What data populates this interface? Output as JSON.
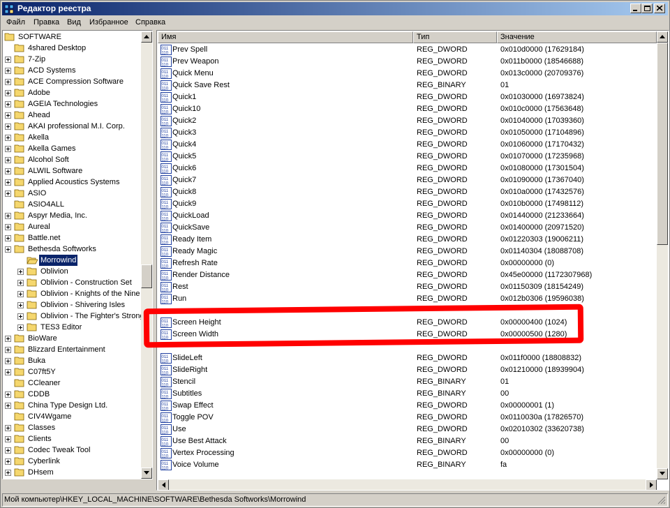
{
  "window": {
    "title": "Редактор реестра",
    "minimize_icon": "minimize-icon",
    "maximize_icon": "maximize-icon",
    "close_icon": "close-icon"
  },
  "menu": [
    "Файл",
    "Правка",
    "Вид",
    "Избранное",
    "Справка"
  ],
  "tree": {
    "root": "SOFTWARE",
    "items": [
      {
        "label": "4shared Desktop",
        "depth": 1,
        "expander": false
      },
      {
        "label": "7-Zip",
        "depth": 1,
        "expander": true
      },
      {
        "label": "ACD Systems",
        "depth": 1,
        "expander": true
      },
      {
        "label": "ACE Compression Software",
        "depth": 1,
        "expander": true
      },
      {
        "label": "Adobe",
        "depth": 1,
        "expander": true
      },
      {
        "label": "AGEIA Technologies",
        "depth": 1,
        "expander": true
      },
      {
        "label": "Ahead",
        "depth": 1,
        "expander": true
      },
      {
        "label": "AKAI professional M.I. Corp.",
        "depth": 1,
        "expander": true
      },
      {
        "label": "Akella",
        "depth": 1,
        "expander": true
      },
      {
        "label": "Akella Games",
        "depth": 1,
        "expander": true
      },
      {
        "label": "Alcohol Soft",
        "depth": 1,
        "expander": true
      },
      {
        "label": "ALWIL Software",
        "depth": 1,
        "expander": true
      },
      {
        "label": "Applied Acoustics Systems",
        "depth": 1,
        "expander": true
      },
      {
        "label": "ASIO",
        "depth": 1,
        "expander": true
      },
      {
        "label": "ASIO4ALL",
        "depth": 1,
        "expander": false
      },
      {
        "label": "Aspyr Media, Inc.",
        "depth": 1,
        "expander": true
      },
      {
        "label": "Aureal",
        "depth": 1,
        "expander": true
      },
      {
        "label": "Battle.net",
        "depth": 1,
        "expander": true
      },
      {
        "label": "Bethesda Softworks",
        "depth": 1,
        "expander": true
      },
      {
        "label": "Morrowind",
        "depth": 2,
        "expander": false,
        "selected": true,
        "open": true
      },
      {
        "label": "Oblivion",
        "depth": 2,
        "expander": true
      },
      {
        "label": "Oblivion - Construction Set",
        "depth": 2,
        "expander": true
      },
      {
        "label": "Oblivion - Knights of the Nine",
        "depth": 2,
        "expander": true
      },
      {
        "label": "Oblivion - Shivering Isles",
        "depth": 2,
        "expander": true
      },
      {
        "label": "Oblivion - The Fighter's Strong",
        "depth": 2,
        "expander": true
      },
      {
        "label": "TES3 Editor",
        "depth": 2,
        "expander": true
      },
      {
        "label": "BioWare",
        "depth": 1,
        "expander": true
      },
      {
        "label": "Blizzard Entertainment",
        "depth": 1,
        "expander": true
      },
      {
        "label": "Buka",
        "depth": 1,
        "expander": true
      },
      {
        "label": "C07ft5Y",
        "depth": 1,
        "expander": true
      },
      {
        "label": "CCleaner",
        "depth": 1,
        "expander": false
      },
      {
        "label": "CDDB",
        "depth": 1,
        "expander": true
      },
      {
        "label": "China Type Design Ltd.",
        "depth": 1,
        "expander": true
      },
      {
        "label": "CIV4Wgame",
        "depth": 1,
        "expander": false
      },
      {
        "label": "Classes",
        "depth": 1,
        "expander": true
      },
      {
        "label": "Clients",
        "depth": 1,
        "expander": true
      },
      {
        "label": "Codec Tweak Tool",
        "depth": 1,
        "expander": true
      },
      {
        "label": "Cyberlink",
        "depth": 1,
        "expander": true
      },
      {
        "label": "DHsem",
        "depth": 1,
        "expander": true
      }
    ]
  },
  "list": {
    "columns": [
      "Имя",
      "Тип",
      "Значение"
    ],
    "rows": [
      {
        "name": "Prev Spell",
        "type": "REG_DWORD",
        "value": "0x010d0000 (17629184)"
      },
      {
        "name": "Prev Weapon",
        "type": "REG_DWORD",
        "value": "0x011b0000 (18546688)"
      },
      {
        "name": "Quick Menu",
        "type": "REG_DWORD",
        "value": "0x013c0000 (20709376)"
      },
      {
        "name": "Quick Save Rest",
        "type": "REG_BINARY",
        "value": "01"
      },
      {
        "name": "Quick1",
        "type": "REG_DWORD",
        "value": "0x01030000 (16973824)"
      },
      {
        "name": "Quick10",
        "type": "REG_DWORD",
        "value": "0x010c0000 (17563648)"
      },
      {
        "name": "Quick2",
        "type": "REG_DWORD",
        "value": "0x01040000 (17039360)"
      },
      {
        "name": "Quick3",
        "type": "REG_DWORD",
        "value": "0x01050000 (17104896)"
      },
      {
        "name": "Quick4",
        "type": "REG_DWORD",
        "value": "0x01060000 (17170432)"
      },
      {
        "name": "Quick5",
        "type": "REG_DWORD",
        "value": "0x01070000 (17235968)"
      },
      {
        "name": "Quick6",
        "type": "REG_DWORD",
        "value": "0x01080000 (17301504)"
      },
      {
        "name": "Quick7",
        "type": "REG_DWORD",
        "value": "0x01090000 (17367040)"
      },
      {
        "name": "Quick8",
        "type": "REG_DWORD",
        "value": "0x010a0000 (17432576)"
      },
      {
        "name": "Quick9",
        "type": "REG_DWORD",
        "value": "0x010b0000 (17498112)"
      },
      {
        "name": "QuickLoad",
        "type": "REG_DWORD",
        "value": "0x01440000 (21233664)"
      },
      {
        "name": "QuickSave",
        "type": "REG_DWORD",
        "value": "0x01400000 (20971520)"
      },
      {
        "name": "Ready Item",
        "type": "REG_DWORD",
        "value": "0x01220303 (19006211)"
      },
      {
        "name": "Ready Magic",
        "type": "REG_DWORD",
        "value": "0x01140304 (18088708)"
      },
      {
        "name": "Refresh Rate",
        "type": "REG_DWORD",
        "value": "0x00000000 (0)"
      },
      {
        "name": "Render Distance",
        "type": "REG_DWORD",
        "value": "0x45e00000 (1172307968)"
      },
      {
        "name": "Rest",
        "type": "REG_DWORD",
        "value": "0x01150309 (18154249)"
      },
      {
        "name": "Run",
        "type": "REG_DWORD",
        "value": "0x012b0306 (19596038)"
      },
      {
        "name": "",
        "type": "",
        "value": ""
      },
      {
        "name": "Screen Height",
        "type": "REG_DWORD",
        "value": "0x00000400 (1024)"
      },
      {
        "name": "Screen Width",
        "type": "REG_DWORD",
        "value": "0x00000500 (1280)"
      },
      {
        "name": "",
        "type": "",
        "value": ""
      },
      {
        "name": "SlideLeft",
        "type": "REG_DWORD",
        "value": "0x011f0000 (18808832)"
      },
      {
        "name": "SlideRight",
        "type": "REG_DWORD",
        "value": "0x01210000 (18939904)"
      },
      {
        "name": "Stencil",
        "type": "REG_BINARY",
        "value": "01"
      },
      {
        "name": "Subtitles",
        "type": "REG_BINARY",
        "value": "00"
      },
      {
        "name": "Swap Effect",
        "type": "REG_DWORD",
        "value": "0x00000001 (1)"
      },
      {
        "name": "Toggle POV",
        "type": "REG_DWORD",
        "value": "0x0110030a (17826570)"
      },
      {
        "name": "Use",
        "type": "REG_DWORD",
        "value": "0x02010302 (33620738)"
      },
      {
        "name": "Use Best Attack",
        "type": "REG_BINARY",
        "value": "00"
      },
      {
        "name": "Vertex Processing",
        "type": "REG_DWORD",
        "value": "0x00000000 (0)"
      },
      {
        "name": "Voice Volume",
        "type": "REG_BINARY",
        "value": "fa"
      }
    ]
  },
  "statusbar": {
    "path": "Мой компьютер\\HKEY_LOCAL_MACHINE\\SOFTWARE\\Bethesda Softworks\\Morrowind"
  },
  "colors": {
    "title_gradient_start": "#0a246a",
    "title_gradient_end": "#a6caf0",
    "selection": "#0a246a",
    "annotation": "#ff0000",
    "folder": "#f5d76e"
  },
  "icons": {
    "folder": "folder-icon",
    "folder_open": "folder-open-icon",
    "value": "registry-value-icon",
    "app": "regedit-icon"
  }
}
